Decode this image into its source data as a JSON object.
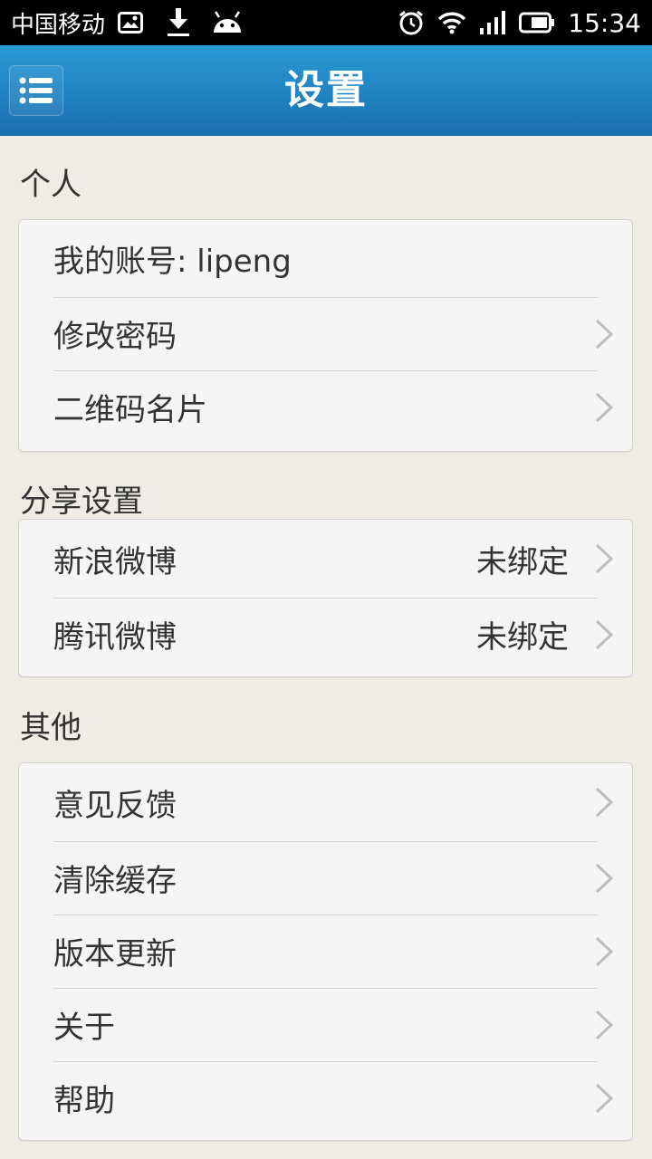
{
  "status_bar": {
    "carrier": "中国移动",
    "time": "15:34",
    "icons": [
      "image-icon",
      "download-icon",
      "android-icon",
      "alarm-icon",
      "wifi-icon",
      "signal-icon",
      "battery-icon"
    ]
  },
  "header": {
    "title": "设置",
    "menu_icon": "list-menu-icon"
  },
  "sections": {
    "personal": {
      "title": "个人",
      "items": [
        {
          "label": "我的账号: lipeng"
        },
        {
          "label": "修改密码"
        },
        {
          "label": "二维码名片"
        }
      ]
    },
    "share": {
      "title": "分享设置",
      "items": [
        {
          "label": "新浪微博",
          "value": "未绑定"
        },
        {
          "label": "腾讯微博",
          "value": "未绑定"
        }
      ]
    },
    "other": {
      "title": "其他",
      "items": [
        {
          "label": "意见反馈"
        },
        {
          "label": "清除缓存"
        },
        {
          "label": "版本更新"
        },
        {
          "label": "关于"
        },
        {
          "label": "帮助"
        }
      ]
    }
  },
  "colors": {
    "header_top": "#2a9ad6",
    "header_bottom": "#1a6fb0",
    "background": "#efebe5",
    "card": "#f5f5f5"
  }
}
